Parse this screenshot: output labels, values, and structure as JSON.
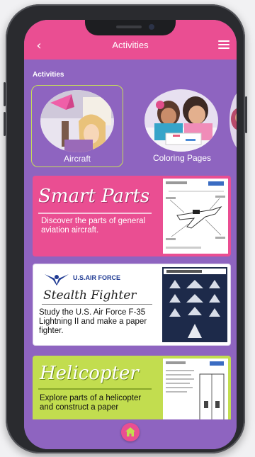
{
  "header": {
    "back_icon": "chevron-left-icon",
    "title": "Activities",
    "menu_icon": "hamburger-menu-icon"
  },
  "section_label": "Activities",
  "categories": [
    {
      "label": "Aircraft",
      "selected": true
    },
    {
      "label": "Coloring Pages",
      "selected": false
    }
  ],
  "cards": [
    {
      "title": "Smart Parts",
      "description": "Discover the parts of general aviation aircraft.",
      "color": "#ea4e92"
    },
    {
      "brand": "U.S.AIR FORCE",
      "title": "Stealth Fighter",
      "description": "Study the U.S. Air Force F-35 Lightning II and make a paper fighter.",
      "color": "#ffffff"
    },
    {
      "title": "Helicopter",
      "description": "Explore parts of a helicopter and construct a paper",
      "color": "#c2dd4f"
    }
  ],
  "bottom_nav": {
    "home_icon": "home-icon"
  },
  "colors": {
    "accent": "#ea4e92",
    "background": "#8e64c0",
    "green": "#c2dd4f"
  }
}
